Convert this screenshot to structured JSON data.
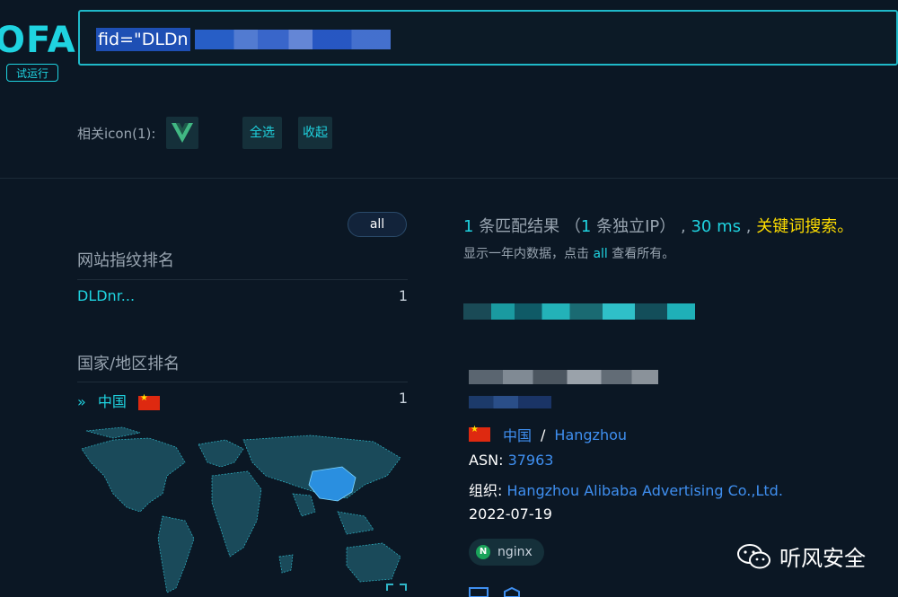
{
  "header": {
    "logo_text": "OFA",
    "trial_badge": "试运行",
    "search_value": "fid=\"DLDn"
  },
  "icons": {
    "label": "相关icon(1):",
    "select_all": "全选",
    "collapse": "收起"
  },
  "sidebar": {
    "all_button": "all",
    "fingerprint_title": "网站指纹排名",
    "fingerprint_items": [
      {
        "name": "DLDnr...",
        "count": "1"
      }
    ],
    "country_title": "国家/地区排名",
    "country_items": [
      {
        "name": "中国",
        "count": "1"
      }
    ]
  },
  "results": {
    "count": "1",
    "count_suffix": "条匹配结果",
    "ip_prefix": "（",
    "ip_count": "1",
    "ip_suffix": "条独立IP）",
    "comma1": ",",
    "time": "30 ms",
    "comma2": ",",
    "keyword_search": "关键词搜索。",
    "note_prefix": "显示一年内数据，点击",
    "note_all": "all",
    "note_suffix": "查看所有。"
  },
  "host": {
    "country": "中国",
    "separator": "/",
    "city": "Hangzhou",
    "asn_label": "ASN:",
    "asn_value": "37963",
    "org_label": "组织:",
    "org_value": "Hangzhou Alibaba Advertising Co.,Ltd.",
    "date": "2022-07-19",
    "server": "nginx"
  },
  "watermark": {
    "text": "听风安全"
  },
  "colors": {
    "background": "#0b1724",
    "accent": "#1fd3e0",
    "link": "#3f8ff0",
    "highlight": "#ffde00"
  }
}
